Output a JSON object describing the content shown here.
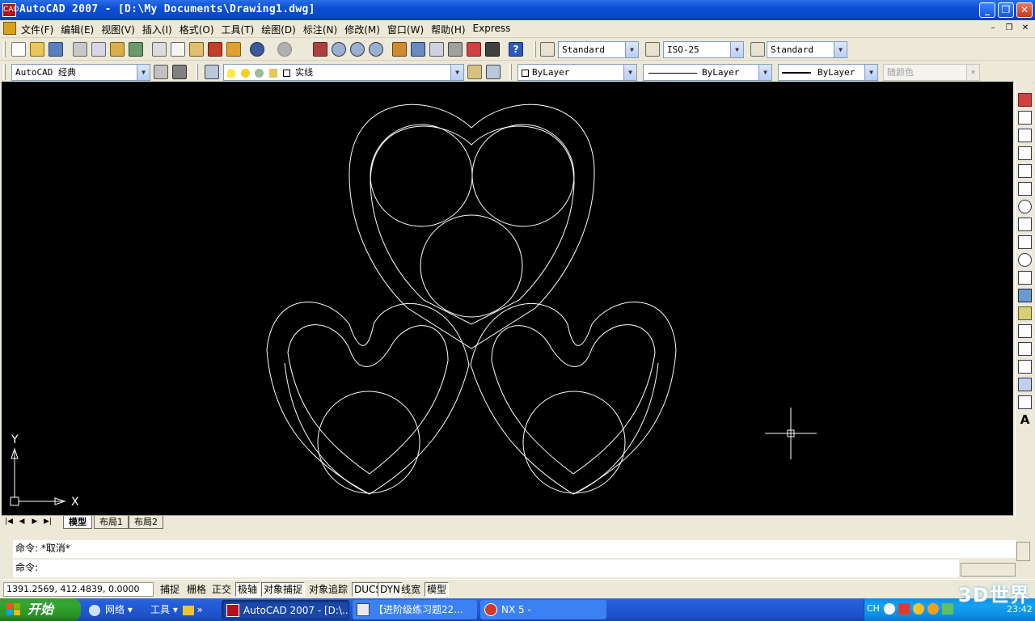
{
  "window": {
    "title": "AutoCAD 2007 - [D:\\My Documents\\Drawing1.dwg]",
    "app_icon_text": "CAD",
    "minimize": "_",
    "restore": "❐",
    "close": "✕"
  },
  "menu": {
    "items": [
      "文件(F)",
      "编辑(E)",
      "视图(V)",
      "插入(I)",
      "格式(O)",
      "工具(T)",
      "绘图(D)",
      "标注(N)",
      "修改(M)",
      "窗口(W)",
      "帮助(H)",
      "Express"
    ],
    "mdi_buttons": [
      "–",
      "❐",
      "✕"
    ]
  },
  "toolbar": {
    "text_style": "Standard",
    "dim_style": "ISO-25",
    "table_style": "Standard",
    "workspace": "AutoCAD 经典",
    "layer": "实线",
    "color": "ByLayer",
    "linetype": "ByLayer",
    "lineweight": "ByLayer",
    "plot_style": "随颜色"
  },
  "drawing": {
    "background": "#000000",
    "stroke": "#ffffff",
    "ucs_x": "X",
    "ucs_y": "Y"
  },
  "layout_tabs": {
    "tabs": [
      "模型",
      "布局1",
      "布局2"
    ],
    "active": "模型"
  },
  "command": {
    "line1": "命令: *取消*",
    "line2": "命令:"
  },
  "status": {
    "coordinates": "1391.2569, 412.4839, 0.0000",
    "buttons": [
      {
        "label": "捕捉",
        "on": false
      },
      {
        "label": "栅格",
        "on": false
      },
      {
        "label": "正交",
        "on": false
      },
      {
        "label": "极轴",
        "on": true
      },
      {
        "label": "对象捕捉",
        "on": true
      },
      {
        "label": "对象追踪",
        "on": false
      },
      {
        "label": "DUCS",
        "on": true
      },
      {
        "label": "DYN",
        "on": true
      },
      {
        "label": "线宽",
        "on": false
      },
      {
        "label": "模型",
        "on": true
      }
    ]
  },
  "taskbar": {
    "start": "开始",
    "quick_network": "网络",
    "quick_tools": "工具",
    "tasks": [
      "AutoCAD 2007 - [D:\\...",
      "【进阶级练习题22...",
      "NX 5 -"
    ],
    "tray_lang": "CH",
    "clock": "23:42",
    "watermark": "3D世界"
  }
}
